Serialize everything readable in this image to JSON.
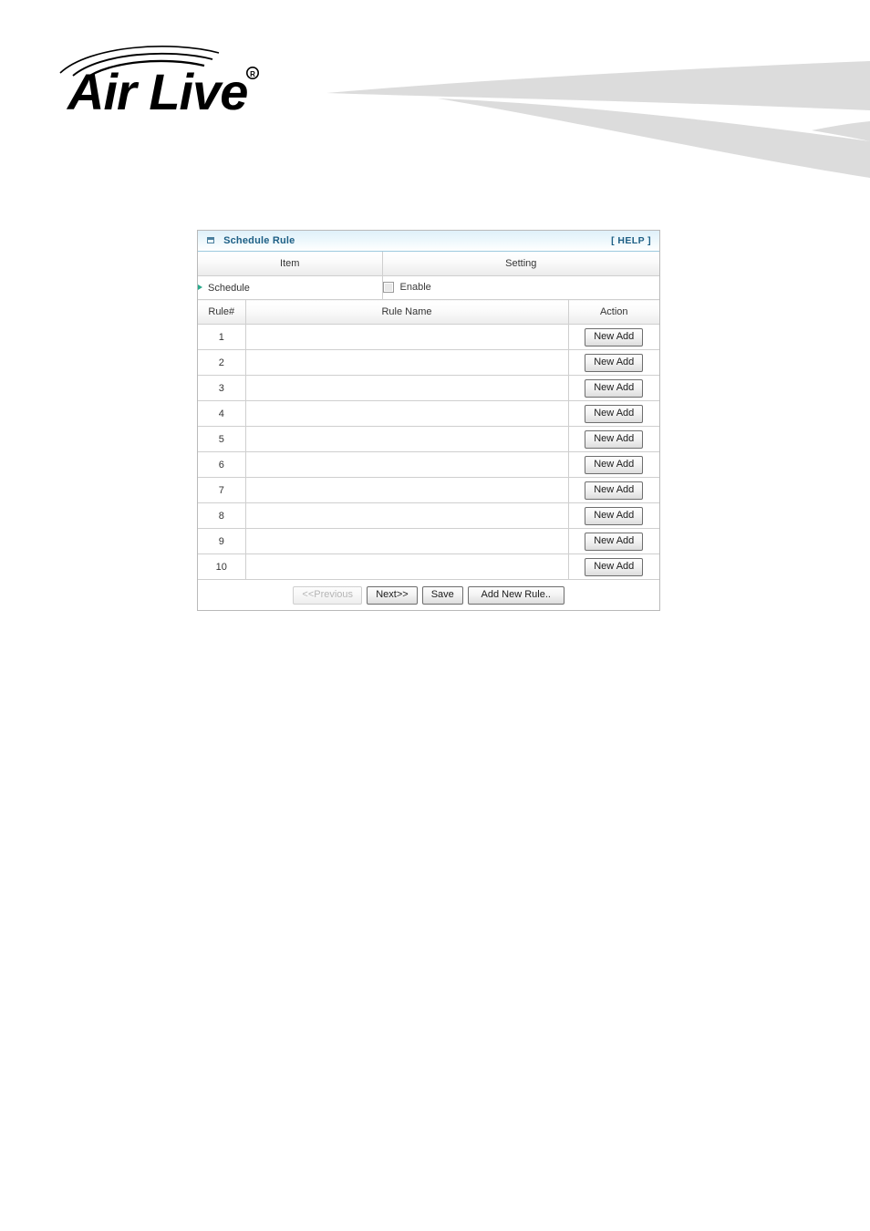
{
  "brand": {
    "name": "Air Live",
    "trademark": "®",
    "logo_alt": "airlive-logo"
  },
  "panel": {
    "window_icon": "window-icon",
    "title": "Schedule Rule",
    "help_label": "[ HELP ]"
  },
  "settings_table": {
    "headers": {
      "item": "Item",
      "setting": "Setting"
    },
    "rows": [
      {
        "item": "Schedule",
        "checkbox_checked": false,
        "checkbox_label": "Enable"
      }
    ]
  },
  "rules_table": {
    "headers": {
      "rule_num": "Rule#",
      "rule_name": "Rule Name",
      "action": "Action"
    },
    "action_label": "New Add",
    "rows": [
      {
        "num": "1",
        "name": ""
      },
      {
        "num": "2",
        "name": ""
      },
      {
        "num": "3",
        "name": ""
      },
      {
        "num": "4",
        "name": ""
      },
      {
        "num": "5",
        "name": ""
      },
      {
        "num": "6",
        "name": ""
      },
      {
        "num": "7",
        "name": ""
      },
      {
        "num": "8",
        "name": ""
      },
      {
        "num": "9",
        "name": ""
      },
      {
        "num": "10",
        "name": ""
      }
    ]
  },
  "footer": {
    "previous_label": "<<Previous",
    "previous_disabled": true,
    "next_label": "Next>>",
    "save_label": "Save",
    "add_new_rule_label": "Add New Rule.."
  },
  "colors": {
    "titlebar_text": "#1d5f85",
    "titlebar_gradient_top": "#dff0f9",
    "panel_border": "#b9b9b9",
    "grid_border": "#cfcfcf",
    "bullet_arrow": "#2aa98b",
    "swoosh_gray": "#dcdcdc",
    "button_border": "#6e6e6e",
    "disabled_text": "#b5b5b5"
  }
}
